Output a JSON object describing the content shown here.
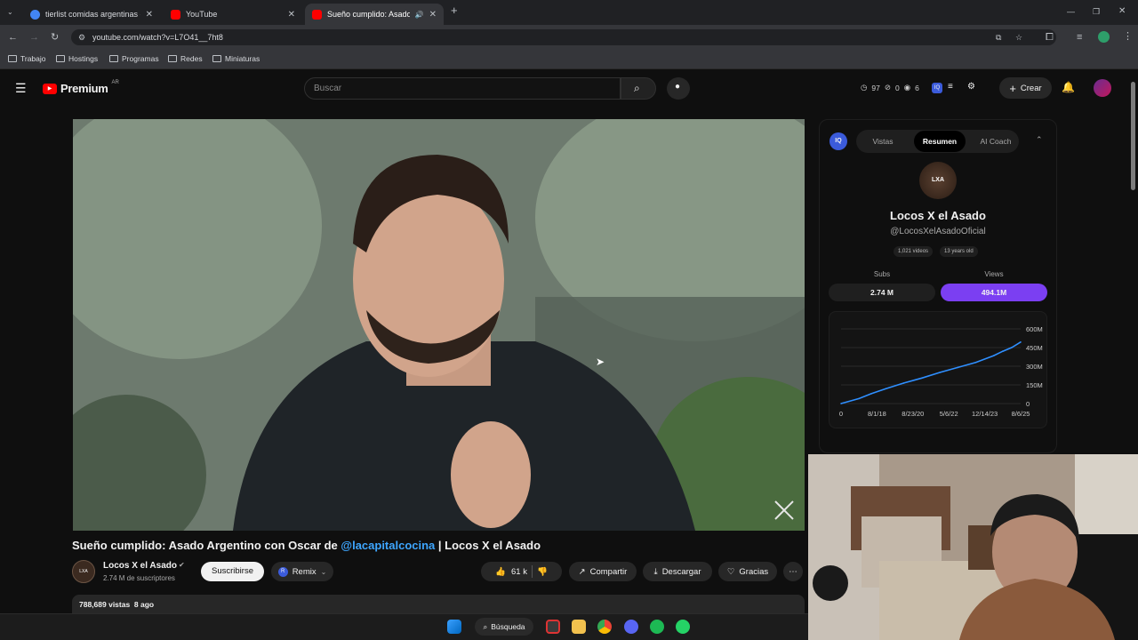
{
  "browser": {
    "tabs": [
      {
        "title": "tierlist comidas argentinas - Bu",
        "favicon_color": "#4285f4",
        "active": false
      },
      {
        "title": "YouTube",
        "favicon_color": "#ff0000",
        "active": false
      },
      {
        "title": "Sueño cumplido: Asado Ar...",
        "favicon_color": "#ff0000",
        "active": true
      }
    ],
    "new_tab": "+",
    "url": "youtube.com/watch?v=L7O41__7ht8",
    "bookmarks": [
      "Trabajo",
      "Hostings",
      "Programas",
      "Redes",
      "Miniaturas"
    ]
  },
  "youtube": {
    "logo_text": "Premium",
    "region": "AR",
    "search_placeholder": "Buscar",
    "ext_counters": {
      "a": "97",
      "b": "0",
      "c": "6"
    },
    "create_label": "Crear"
  },
  "video": {
    "title_prefix": "Sueño cumplido: Asado Argentino con Oscar de ",
    "title_mention": "@lacapitalcocina",
    "title_suffix": " | Locos X el Asado",
    "channel_name": "Locos X el Asado",
    "subscribers": "2.74 M de suscriptores",
    "subscribe_label": "Suscribirse",
    "remix_label": "Remix",
    "likes": "61 k",
    "share_label": "Compartir",
    "download_label": "Descargar",
    "thanks_label": "Gracias",
    "views_line": "788,689 vistas  8 ago"
  },
  "panel": {
    "tabs": [
      "Vistas",
      "Resumen",
      "AI Coach"
    ],
    "active_tab": "Resumen",
    "channel_name": "Locos X el Asado",
    "handle": "@LocosXelAsadoOficial",
    "videos_badge": "1,021 videos",
    "age_badge": "13 years old",
    "subs_label": "Subs",
    "views_label": "Views",
    "subs_value": "2.74 M",
    "views_value": "494.1M",
    "accent": "#7b3ff2"
  },
  "chart_data": {
    "type": "line",
    "x_ticks": [
      "0",
      "8/1/18",
      "8/23/20",
      "5/6/22",
      "12/14/23",
      "8/6/25"
    ],
    "y_ticks": [
      "600M",
      "450M",
      "300M",
      "150M",
      "0"
    ],
    "ylim": [
      0,
      600
    ],
    "series": [
      {
        "x": [
          0.0,
          0.1,
          0.17,
          0.25,
          0.35,
          0.45,
          0.55,
          0.65,
          0.75,
          0.85,
          0.9,
          0.95,
          1.0
        ],
        "values": [
          0,
          40,
          80,
          120,
          165,
          205,
          250,
          290,
          330,
          385,
          420,
          450,
          494
        ]
      }
    ]
  },
  "taskbar": {
    "search_label": "Búsqueda"
  }
}
